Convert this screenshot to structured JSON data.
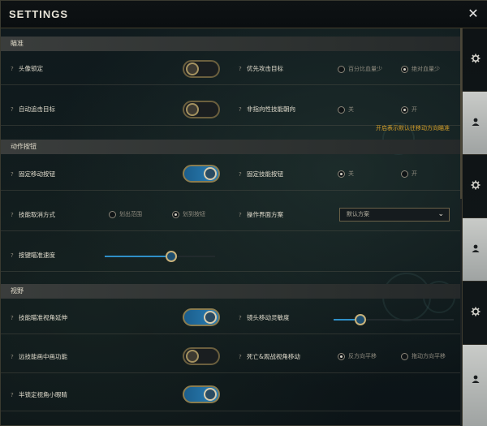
{
  "window": {
    "title": "SETTINGS",
    "close_icon": "close-icon"
  },
  "sections": [
    {
      "header": "瞄准"
    },
    {
      "header": "动作按钮"
    },
    {
      "header": "视野"
    }
  ],
  "aim": {
    "head_lock": {
      "label": "头像锁定",
      "enabled": false
    },
    "priority_target": {
      "label": "优先攻击目标",
      "options": [
        "百分比血量少",
        "绝对血量少"
      ],
      "selected": 1
    },
    "auto_attack": {
      "label": "自动追击目标",
      "enabled": false
    },
    "non_directional": {
      "label": "非指向性技能朝向",
      "options": [
        "关",
        "开"
      ],
      "selected": 1,
      "hint": "开启表示默认往移动方向瞄准"
    }
  },
  "action_buttons": {
    "fixed_move": {
      "label": "固定移动按钮",
      "enabled": true
    },
    "fixed_skill": {
      "label": "固定技能按钮",
      "options": [
        "关",
        "开"
      ],
      "selected": 0
    },
    "cancel_mode": {
      "label": "技能取消方式",
      "options": [
        "划出范围",
        "划到按钮"
      ],
      "selected": 1
    },
    "ui_scheme": {
      "label": "操作界面方案",
      "value": "默认方案"
    },
    "aim_speed": {
      "label": "按键瞄准速度",
      "value": 0.6
    }
  },
  "view": {
    "aim_extend": {
      "label": "技能瞄准视角延伸",
      "enabled": true
    },
    "lens_sensitivity": {
      "label": "镜头移动灵敏度",
      "value": 0.22
    },
    "ranged_zoom": {
      "label": "远技能画中画功能",
      "enabled": false
    },
    "death_move": {
      "label": "死亡&观战视角移动",
      "options": [
        "反方向平移",
        "拖动方向平移"
      ],
      "selected": 0
    },
    "half_lock": {
      "label": "半锁定视角小眼睛",
      "enabled": true
    }
  },
  "sidebar": {
    "tabs": [
      {
        "icon": "gear-icon",
        "active": false
      },
      {
        "icon": "user-icon",
        "active": true
      },
      {
        "icon": "gear-icon",
        "active": false
      },
      {
        "icon": "user-icon",
        "active": true
      },
      {
        "icon": "gear-icon",
        "active": false
      },
      {
        "icon": "user-icon",
        "active": true
      }
    ]
  },
  "colors": {
    "accent_blue": "#2f8fc7",
    "gold_border": "#8a7c4f",
    "hint_orange": "#d6a02a"
  }
}
